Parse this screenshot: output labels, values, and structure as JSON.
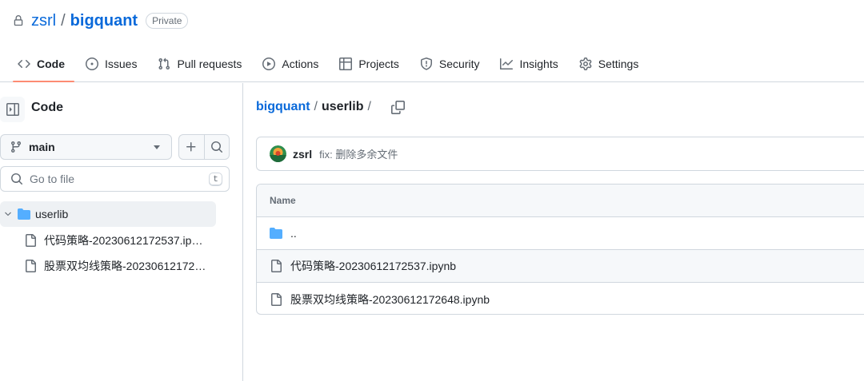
{
  "repo": {
    "owner": "zsrl",
    "separator": "/",
    "name": "bigquant",
    "visibility": "Private"
  },
  "nav": [
    {
      "label": "Code",
      "icon": "code-icon",
      "selected": true
    },
    {
      "label": "Issues",
      "icon": "issue-icon"
    },
    {
      "label": "Pull requests",
      "icon": "pull-request-icon"
    },
    {
      "label": "Actions",
      "icon": "play-icon"
    },
    {
      "label": "Projects",
      "icon": "table-icon"
    },
    {
      "label": "Security",
      "icon": "shield-icon"
    },
    {
      "label": "Insights",
      "icon": "graph-icon"
    },
    {
      "label": "Settings",
      "icon": "gear-icon"
    }
  ],
  "sidebar": {
    "title": "Code",
    "branch": "main",
    "search_placeholder": "Go to file",
    "search_shortcut": "t",
    "tree": {
      "folder": "userlib",
      "files": [
        "代码策略-20230612172537.ipynb",
        "股票双均线策略-202306121726..."
      ]
    }
  },
  "breadcrumb": {
    "repo": "bigquant",
    "folder": "userlib",
    "sep": "/"
  },
  "commit": {
    "user": "zsrl",
    "message": "fix: 删除多余文件"
  },
  "files": {
    "header": "Name",
    "parent": "..",
    "rows": [
      "代码策略-20230612172537.ipynb",
      "股票双均线策略-20230612172648.ipynb"
    ]
  },
  "colors": {
    "link": "#0969da",
    "accent_underline": "#fd8c73",
    "folder": "#54aeff",
    "border": "#d0d7de"
  }
}
